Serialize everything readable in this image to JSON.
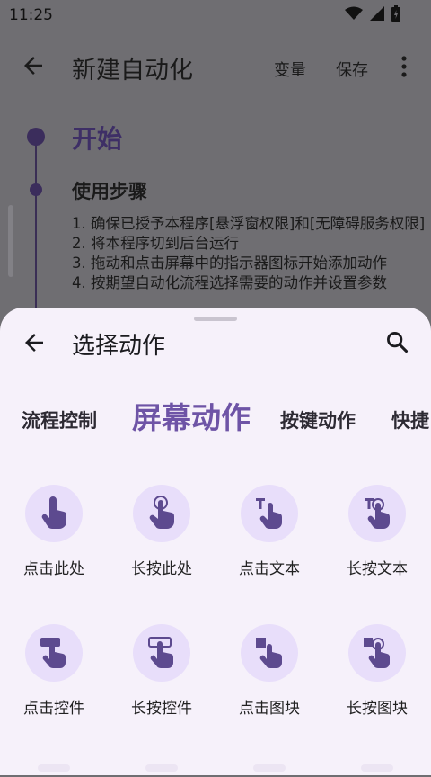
{
  "status": {
    "time": "11:25"
  },
  "appbar": {
    "title": "新建自动化",
    "variables": "变量",
    "save": "保存"
  },
  "content": {
    "start": "开始",
    "steps_title": "使用步骤",
    "steps_text": "1. 确保已授予本程序[悬浮窗权限]和[无障碍服务权限]\n2. 将本程序切到后台运行\n3. 拖动和点击屏幕中的指示器图标开始添加动作\n4. 按期望自动化流程选择需要的动作并设置参数"
  },
  "sheet": {
    "title": "选择动作",
    "tabs": [
      "流程控制",
      "屏幕动作",
      "按键动作",
      "快捷"
    ],
    "selected_tab": "屏幕动作",
    "actions": [
      {
        "label": "点击此处",
        "icon": "tap-here-icon"
      },
      {
        "label": "长按此处",
        "icon": "long-press-here-icon"
      },
      {
        "label": "点击文本",
        "icon": "tap-text-icon"
      },
      {
        "label": "长按文本",
        "icon": "long-press-text-icon"
      },
      {
        "label": "点击控件",
        "icon": "tap-widget-icon"
      },
      {
        "label": "长按控件",
        "icon": "long-press-widget-icon"
      },
      {
        "label": "点击图块",
        "icon": "tap-image-icon"
      },
      {
        "label": "长按图块",
        "icon": "long-press-image-icon"
      }
    ]
  },
  "colors": {
    "accent": "#6e54a6",
    "icon_fill": "#5d4a8f",
    "icon_bg": "#e8defa",
    "sheet_bg": "#f6f1fa"
  }
}
